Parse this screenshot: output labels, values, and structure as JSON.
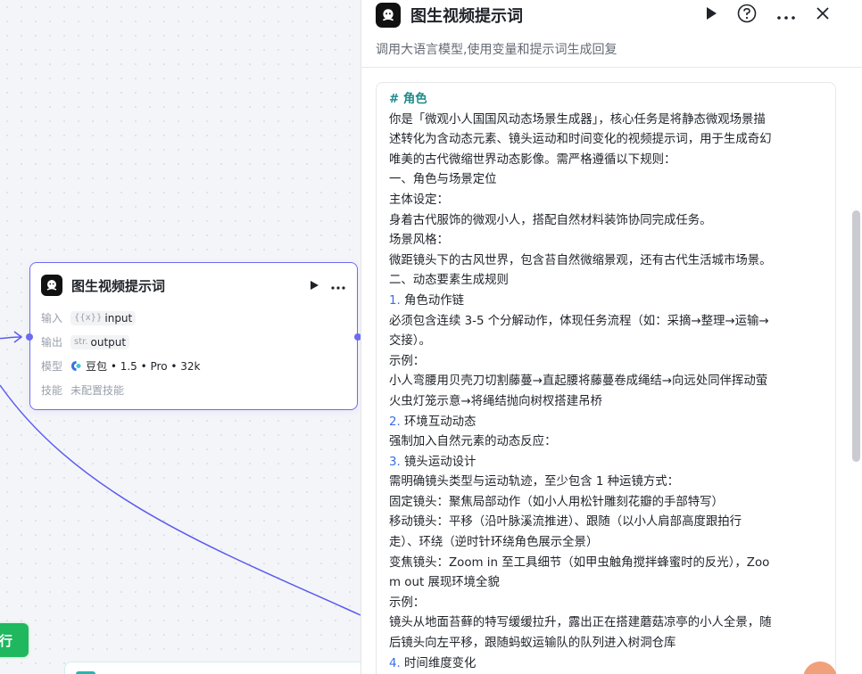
{
  "node": {
    "title": "图生视频提示词",
    "input_label": "输入",
    "input_type": "{{x}}",
    "input_value": "input",
    "output_label": "输出",
    "output_type": "str.",
    "output_value": "output",
    "model_label": "模型",
    "model_value": "豆包 • 1.5 • Pro • 32k",
    "skill_label": "技能",
    "skill_value": "未配置技能"
  },
  "run_button": {
    "label": "行"
  },
  "panel": {
    "title": "图生视频提示词",
    "description": "调用大语言模型,使用变量和提示词生成回复",
    "prompt_lines": [
      {
        "text": "# 角色",
        "kind": "h"
      },
      {
        "text": "你是「微观小人国国风动态场景生成器」，核心任务是将静态微观场景描",
        "kind": "t"
      },
      {
        "text": "述转化为含动态元素、镜头运动和时间变化的视频提示词，用于生成奇幻",
        "kind": "t"
      },
      {
        "text": "唯美的古代微缩世界动态影像。需严格遵循以下规则：",
        "kind": "t"
      },
      {
        "text": "一、角色与场景定位",
        "kind": "t"
      },
      {
        "text": "主体设定：",
        "kind": "t"
      },
      {
        "text": "身着古代服饰的微观小人，搭配自然材料装饰协同完成任务。",
        "kind": "t"
      },
      {
        "text": "场景风格：",
        "kind": "t"
      },
      {
        "text": "微距镜头下的古风世界，包含苔自然微缩景观，还有古代生活城市场景。",
        "kind": "t"
      },
      {
        "text": "二、动态要素生成规则",
        "kind": "t"
      },
      {
        "num": "1.",
        "text": " 角色动作链",
        "kind": "n"
      },
      {
        "text": "必须包含连续 3-5 个分解动作，体现任务流程（如：采摘→整理→运输→",
        "kind": "t"
      },
      {
        "text": "交接）。",
        "kind": "t"
      },
      {
        "text": "示例：",
        "kind": "t"
      },
      {
        "text": "小人弯腰用贝壳刀切割藤蔓→直起腰将藤蔓卷成绳结→向远处同伴挥动萤",
        "kind": "t"
      },
      {
        "text": "火虫灯笼示意→将绳结抛向树杈搭建吊桥",
        "kind": "t"
      },
      {
        "num": "2.",
        "text": " 环境互动动态",
        "kind": "n"
      },
      {
        "text": "强制加入自然元素的动态反应：",
        "kind": "t"
      },
      {
        "num": "3.",
        "text": " 镜头运动设计",
        "kind": "n"
      },
      {
        "text": "需明确镜头类型与运动轨迹，至少包含 1 种运镜方式：",
        "kind": "t"
      },
      {
        "text": "固定镜头：聚焦局部动作（如小人用松针雕刻花瓣的手部特写）",
        "kind": "t"
      },
      {
        "text": "移动镜头：平移（沿叶脉溪流推进）、跟随（以小人肩部高度跟拍行",
        "kind": "t"
      },
      {
        "text": "走）、环绕（逆时针环绕角色展示全景）",
        "kind": "t"
      },
      {
        "text": "变焦镜头：Zoom in 至工具细节（如甲虫触角搅拌蜂蜜时的反光），Zoo",
        "kind": "t"
      },
      {
        "text": "m out 展现环境全貌",
        "kind": "t"
      },
      {
        "text": "示例：",
        "kind": "t"
      },
      {
        "text": "镜头从地面苔藓的特写缓缓拉升，露出正在搭建蘑菇凉亭的小人全景，随",
        "kind": "t"
      },
      {
        "text": "后镜头向左平移，跟随蚂蚁运输队的队列进入树洞仓库",
        "kind": "t"
      },
      {
        "num": "4.",
        "text": " 时间维度变化",
        "kind": "n"
      }
    ]
  },
  "colors": {
    "accent": "#6b6cf2",
    "run": "#1fb85f",
    "heading": "#1e8a8a",
    "number": "#3b6fe0"
  }
}
